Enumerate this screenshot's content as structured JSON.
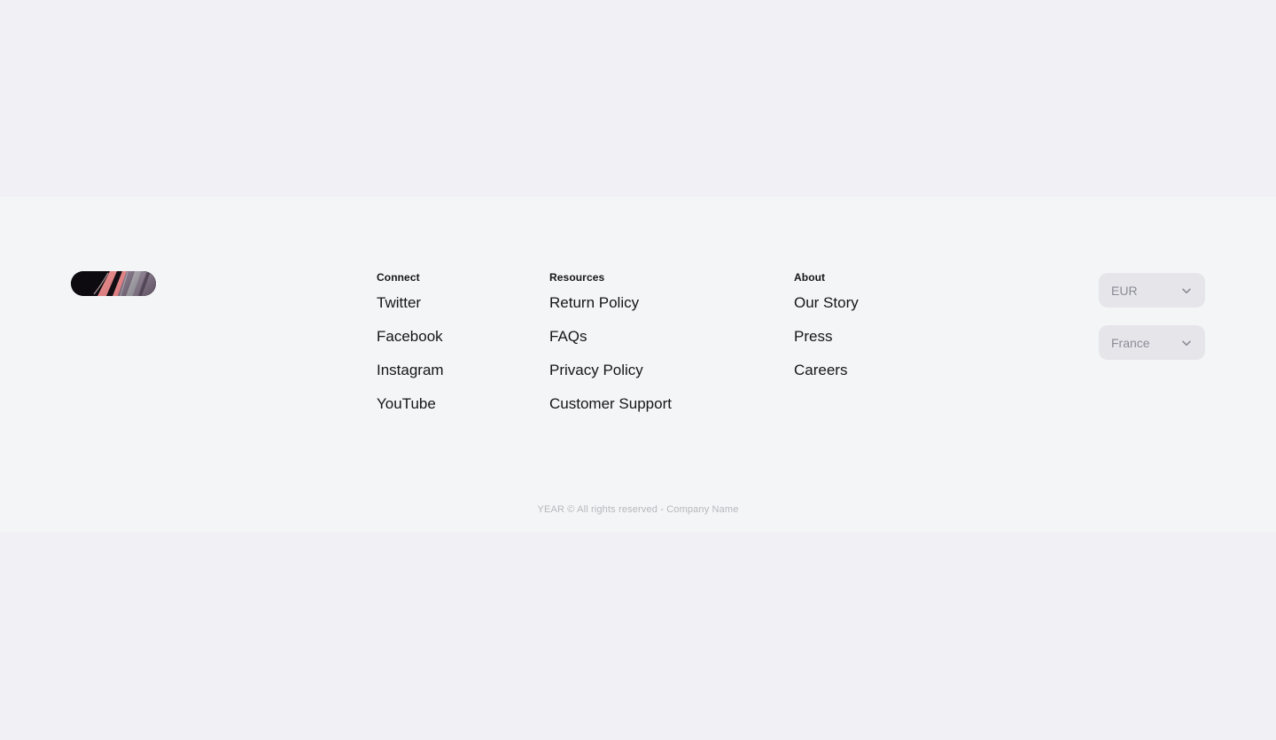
{
  "footer": {
    "logo": {
      "name": "company-logo",
      "alt": "Company logo"
    },
    "columns": [
      {
        "id": "connect",
        "heading": "Connect",
        "links": [
          {
            "label": "Twitter"
          },
          {
            "label": "Facebook"
          },
          {
            "label": "Instagram"
          },
          {
            "label": "YouTube"
          }
        ]
      },
      {
        "id": "resources",
        "heading": "Resources",
        "links": [
          {
            "label": "Return Policy"
          },
          {
            "label": "FAQs"
          },
          {
            "label": "Privacy Policy"
          },
          {
            "label": "Customer Support"
          }
        ]
      },
      {
        "id": "about",
        "heading": "About",
        "links": [
          {
            "label": "Our Story"
          },
          {
            "label": "Press"
          },
          {
            "label": "Careers"
          }
        ]
      }
    ],
    "selects": [
      {
        "id": "currency",
        "value": "EUR",
        "icon": "chevron-down-icon"
      },
      {
        "id": "country",
        "value": "France",
        "icon": "chevron-down-icon"
      }
    ],
    "copyright": "YEAR © All rights reserved - Company Name"
  },
  "colors": {
    "page_background": "#f1f0f5",
    "footer_background": "#f4f5f7",
    "text_primary": "#16151a",
    "text_muted": "#8c8c96",
    "copyright_text": "#b7b7bd",
    "select_background": "#e6e5ea"
  }
}
